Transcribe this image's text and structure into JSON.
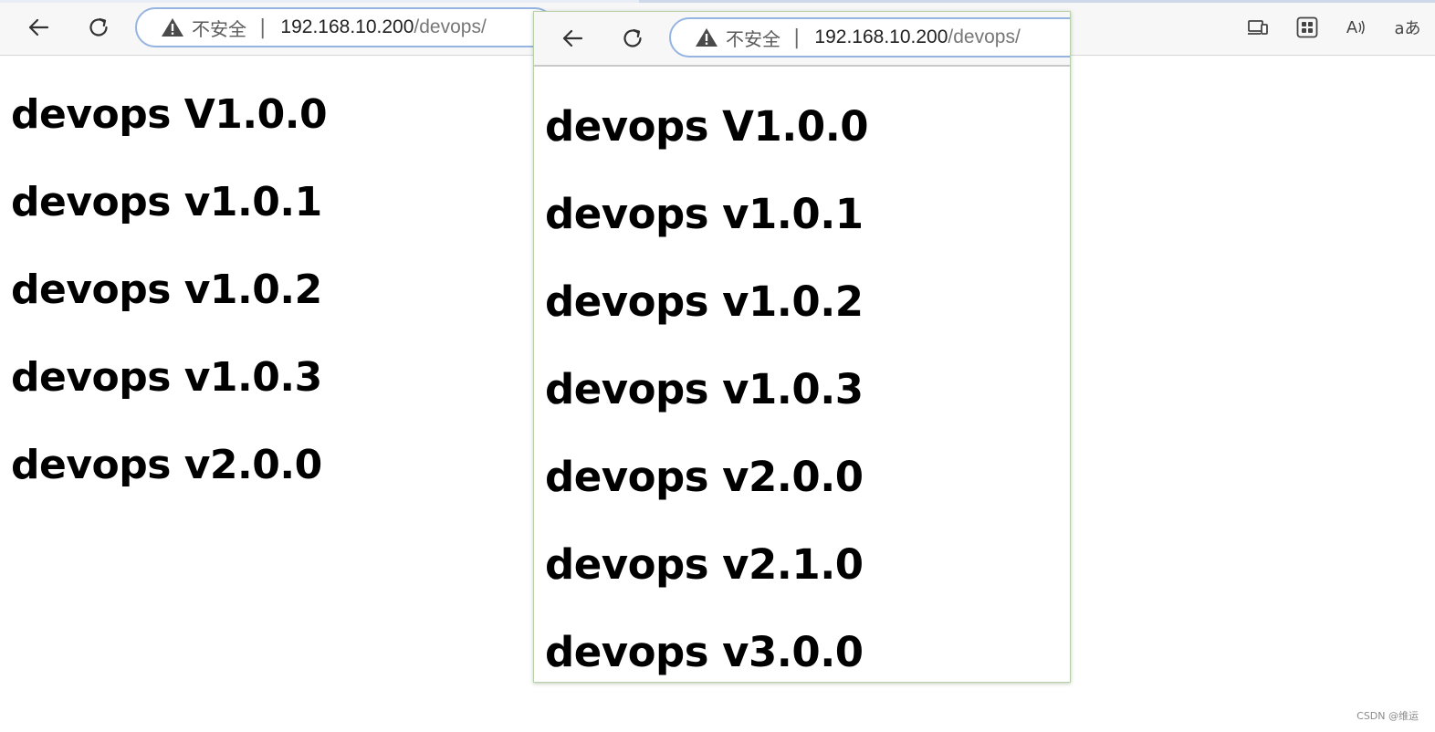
{
  "background_window": {
    "address_bar": {
      "security_label": "不安全",
      "separator": "|",
      "host": "192.168.10.200",
      "path": "/devops/"
    },
    "toolbar_icons": [
      "back-arrow-icon",
      "refresh-icon",
      "devices-icon",
      "apps-grid-icon",
      "read-aloud-icon",
      "translate-icon"
    ],
    "translate_label": "aあ",
    "read_aloud_label": "A",
    "headings": [
      "devops V1.0.0",
      "devops v1.0.1",
      "devops v1.0.2",
      "devops v1.0.3",
      "devops v2.0.0"
    ]
  },
  "foreground_window": {
    "address_bar": {
      "security_label": "不安全",
      "separator": "|",
      "host": "192.168.10.200",
      "path": "/devops/"
    },
    "toolbar_icons": [
      "back-arrow-icon",
      "refresh-icon"
    ],
    "headings": [
      "devops V1.0.0",
      "devops v1.0.1",
      "devops v1.0.2",
      "devops v1.0.3",
      "devops v2.0.0",
      "devops v2.1.0",
      "devops v3.0.0"
    ]
  },
  "watermark": "CSDN @维运",
  "colors": {
    "address_border": "#96b4e2",
    "popup_border": "#b9cfa9",
    "toolbar_bg": "#f7f7f7",
    "heading_text": "#000000",
    "path_text": "#777777"
  }
}
